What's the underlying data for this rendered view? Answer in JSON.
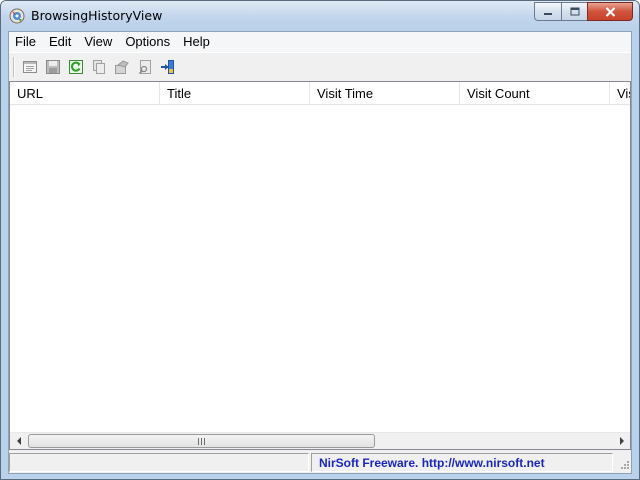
{
  "window": {
    "title": "BrowsingHistoryView",
    "icon": "browsinghistoryview-app-icon",
    "controls": [
      "minimize-icon",
      "maximize-icon",
      "close-icon"
    ]
  },
  "menu": {
    "items": [
      "File",
      "Edit",
      "View",
      "Options",
      "Help"
    ]
  },
  "toolbar": {
    "buttons": [
      {
        "icon": "properties-icon"
      },
      {
        "icon": "save-icon"
      },
      {
        "icon": "refresh-icon"
      },
      {
        "icon": "copy-icon"
      },
      {
        "icon": "html-report-icon"
      },
      {
        "icon": "find-icon"
      },
      {
        "icon": "exit-icon"
      }
    ]
  },
  "list": {
    "columns": [
      "URL",
      "Title",
      "Visit Time",
      "Visit Count",
      "Vis"
    ],
    "rows": []
  },
  "status": {
    "left_text": "",
    "link_text": "NirSoft Freeware.  http://www.nirsoft.net",
    "link_color": "#1b26c2"
  },
  "colors": {
    "titlebar": "#c2d5ec",
    "close_button": "#d0533d"
  }
}
